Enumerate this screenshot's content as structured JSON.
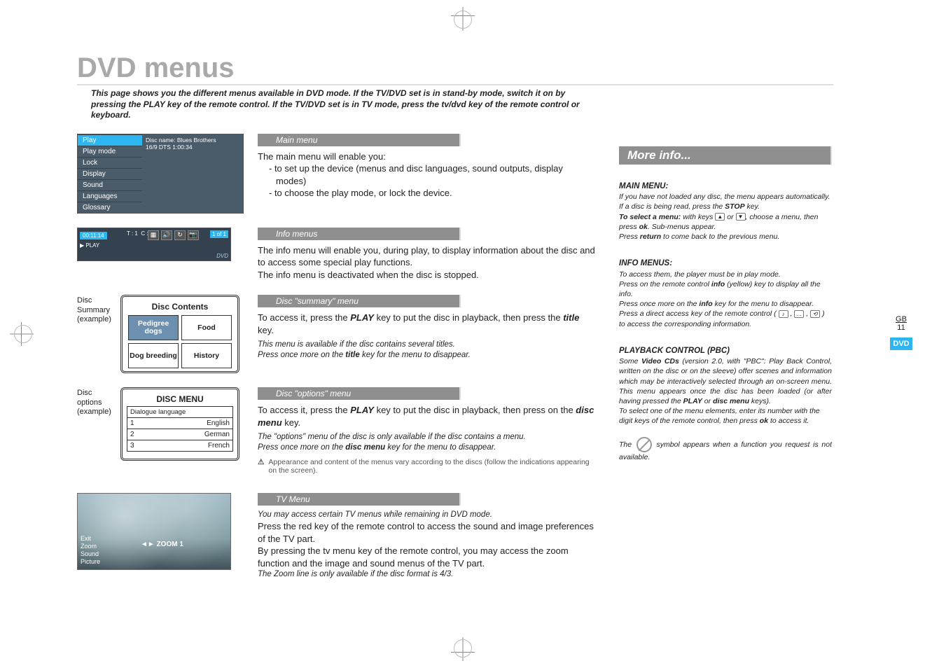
{
  "page_title": "DVD menus",
  "intro": "This page shows you the different menus available in DVD mode. If the TV/DVD set is in stand-by mode, switch it on by pressing the PLAY key of the remote control. If the TV/DVD set is in TV mode, press the tv/dvd key of the remote control or keyboard.",
  "main_menu_shot": {
    "disc_name_line1": "Disc name: Blues Brothers",
    "disc_name_line2": "16/9 DTS 1:00:34",
    "items": [
      "Play",
      "Play mode",
      "Lock",
      "Display",
      "Sound",
      "Languages",
      "Glossary"
    ]
  },
  "sections": {
    "main": {
      "heading": "Main menu",
      "p1": "The main menu will enable you:",
      "b1": "- to set up the device (menus and disc languages, sound outputs, display modes)",
      "b2": "- to choose the play mode, or lock the device."
    },
    "info": {
      "heading": "Info menus",
      "p1": "The info menu will enable you, during play, to display information about the disc and to access some special play functions.",
      "p2": "The info menu is deactivated when the disc is stopped."
    },
    "summary": {
      "heading": "Disc \"summary\" menu",
      "p1a": "To access it, press the ",
      "p1b": " key to put the disc in playback, then press the ",
      "p1c": " key.",
      "key_play": "PLAY",
      "key_title": "title",
      "i1": "This menu is available if the disc contains several titles.",
      "i2a": "Press once more on the ",
      "i2b": " key for the menu to disappear.",
      "i2_key": "title",
      "caption": "Disc\nSummary\n(example)"
    },
    "options": {
      "heading": "Disc \"options\" menu",
      "p1a": "To access it, press the ",
      "p1b": " key to put the disc in playback, then press on the ",
      "p1c": " key.",
      "key_play": "PLAY",
      "key_menu": "disc menu",
      "i1": "The \"options\" menu of the disc is only available if the disc contains a menu.",
      "i2a": "Press once more on the ",
      "i2b": " key for the menu to disappear.",
      "i2_key": "disc menu",
      "warn": "Appearance and content of the menus vary according to the discs (follow the indications appearing on the screen).",
      "caption": "Disc\noptions\n(example)"
    },
    "tv": {
      "heading": "TV Menu",
      "i1": "You may access certain TV menus while remaining in DVD mode.",
      "p1": "Press the red key of the remote control to access the sound and image preferences of the TV part.",
      "p2": "By pressing the tv menu key of the remote control, you may access the zoom function and the image and sound menus of the TV part.",
      "i2": "The Zoom line is only available if the disc format is 4/3."
    }
  },
  "infobar": {
    "time": "00:11:14",
    "play": "▶ PLAY",
    "t": "T : 1",
    "c": "C : 05",
    "of": "1 of 1",
    "dvd": "DVD"
  },
  "disc_contents": {
    "title": "Disc Contents",
    "cells": [
      "Pedigree dogs",
      "Food",
      "Dog breeding",
      "History"
    ]
  },
  "disc_menu": {
    "title": "DISC MENU",
    "sub": "Dialogue language",
    "rows": [
      {
        "n": "1",
        "v": "English"
      },
      {
        "n": "2",
        "v": "German"
      },
      {
        "n": "3",
        "v": "French"
      }
    ]
  },
  "tv_shot": {
    "items": [
      "Exit",
      "Zoom",
      "Sound",
      "Picture"
    ],
    "zoom": "ZOOM 1"
  },
  "sidebar": {
    "header": "More info...",
    "main": {
      "h": "MAIN MENU:",
      "l1": "If you have not loaded any disc, the menu appears automatically.",
      "l2a": "If a disc is being read, press the ",
      "l2b": " key.",
      "l2_key": "STOP",
      "l3a": "To select a menu:",
      "l3b": " with keys ",
      "l3c": " or ",
      "l3d": ", choose a menu, then press ",
      "l3e": ". Sub-menus appear.",
      "l3_key": "ok",
      "l4a": "Press ",
      "l4b": " to come back to the previous menu.",
      "l4_key": "return"
    },
    "info": {
      "h": "INFO MENUS:",
      "l1": "To access them, the player must be in play mode.",
      "l2a": "Press on the remote control ",
      "l2b": " (yellow) key to display all the info.",
      "l2_key": "info",
      "l3a": "Press once more on the ",
      "l3b": " key for the menu to disappear.",
      "l3_key": "info",
      "l4": "Press a direct access key of the remote control (",
      "l4b": ") to access the corresponding information."
    },
    "pbc": {
      "h": "PLAYBACK CONTROL (PBC)",
      "l1a": "Some ",
      "l1b": " (version 2.0, with \"PBC\": Play Back Control, written on the disc or on the sleeve) offer scenes and information which may be interactively selected through an on-screen menu. This menu appears once the disc has been loaded (or after having pressed the ",
      "l1c": " or ",
      "l1d": " keys).",
      "l1_key1": "Video CDs",
      "l1_key2": "PLAY",
      "l1_key3": "disc menu",
      "l2a": "To select one of the menu elements, enter its number with the digit keys of the remote control, then press ",
      "l2b": " to access it.",
      "l2_key": "ok",
      "sym_a": "The ",
      "sym_b": " symbol appears when a function you request is not available."
    }
  },
  "page_marker": {
    "gb": "GB",
    "num": "11",
    "dvd": "DVD"
  }
}
